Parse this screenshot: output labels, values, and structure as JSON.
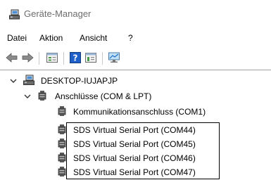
{
  "window": {
    "title": "Geräte-Manager",
    "title_icon": "device-manager-icon"
  },
  "menu": {
    "items": [
      "Datei",
      "Aktion",
      "Ansicht",
      "?"
    ]
  },
  "toolbar": {
    "buttons": [
      "back-arrow-icon",
      "forward-arrow-icon",
      "properties-icon",
      "help-icon",
      "view-icon",
      "monitor-icon"
    ]
  },
  "tree": {
    "root": {
      "label": "DESKTOP-IUJAPJP",
      "icon": "computer-icon",
      "expanded": true
    },
    "category": {
      "label": "Anschlüsse (COM & LPT)",
      "icon": "port-icon",
      "expanded": true
    },
    "devices": [
      {
        "label": "Kommunikationsanschluss (COM1)",
        "icon": "port-icon"
      },
      {
        "label": "SDS Virtual Serial Port (COM44)",
        "icon": "port-icon"
      },
      {
        "label": "SDS Virtual Serial Port (COM45)",
        "icon": "port-icon"
      },
      {
        "label": "SDS Virtual Serial Port (COM46)",
        "icon": "port-icon"
      },
      {
        "label": "SDS Virtual Serial Port (COM47)",
        "icon": "port-icon"
      }
    ]
  },
  "colors": {
    "title_text": "#6d6d6d",
    "help_blue": "#1e5fc8",
    "icon_gray": "#5a5a5a"
  }
}
